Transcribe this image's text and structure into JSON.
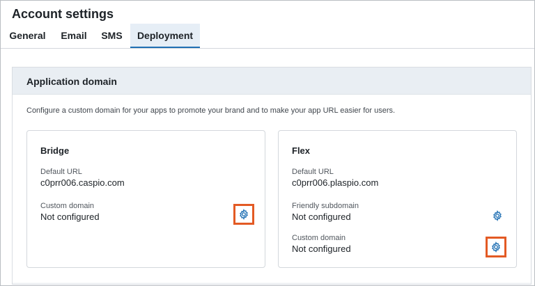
{
  "page": {
    "title": "Account settings"
  },
  "tabs": [
    {
      "label": "General"
    },
    {
      "label": "Email"
    },
    {
      "label": "SMS"
    },
    {
      "label": "Deployment"
    }
  ],
  "panel": {
    "title": "Application domain",
    "description": "Configure a custom domain for your apps to promote your brand and to make your app URL easier for users."
  },
  "cards": {
    "bridge": {
      "title": "Bridge",
      "default_url_label": "Default URL",
      "default_url_value": "c0prr006.caspio.com",
      "custom_domain_label": "Custom domain",
      "custom_domain_value": "Not configured"
    },
    "flex": {
      "title": "Flex",
      "default_url_label": "Default URL",
      "default_url_value": "c0prr006.plaspio.com",
      "friendly_subdomain_label": "Friendly subdomain",
      "friendly_subdomain_value": "Not configured",
      "custom_domain_label": "Custom domain",
      "custom_domain_value": "Not configured"
    }
  },
  "icons": {
    "settings": "gear-icon"
  },
  "colors": {
    "accent": "#1f6fb3",
    "highlight": "#e35a24",
    "active_tab_bg": "#e6eef6"
  }
}
